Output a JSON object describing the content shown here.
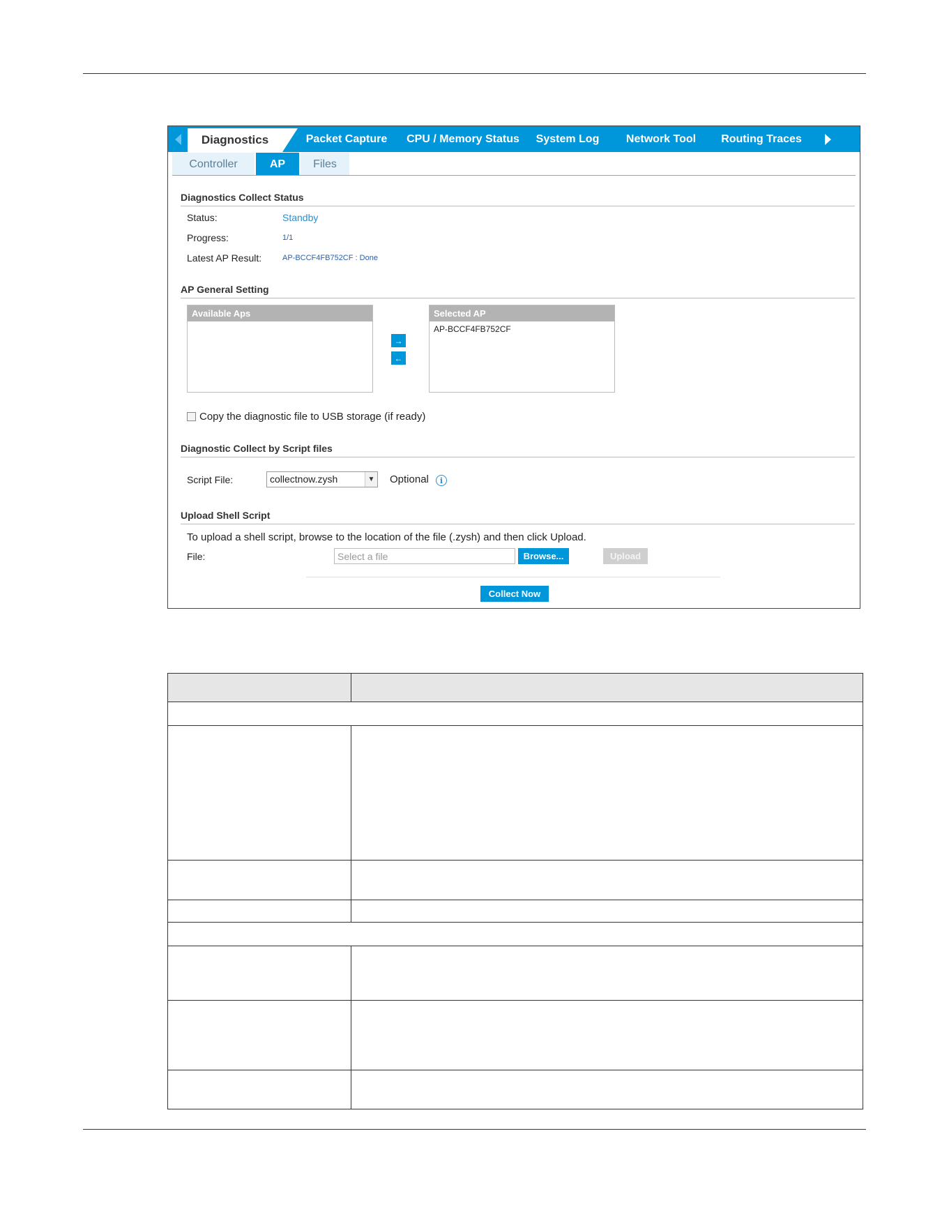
{
  "tabs": {
    "items": [
      "Diagnostics",
      "Packet Capture",
      "CPU / Memory Status",
      "System Log",
      "Network Tool",
      "Routing Traces"
    ],
    "active": "Diagnostics"
  },
  "subtabs": {
    "items": [
      "Controller",
      "AP",
      "Files"
    ],
    "active": "AP"
  },
  "collect_status": {
    "title": "Diagnostics Collect Status",
    "status_label": "Status:",
    "status_value": "Standby",
    "progress_label": "Progress:",
    "progress_value": "1/1",
    "latest_label": "Latest AP Result:",
    "latest_value": "AP-BCCF4FB752CF : Done"
  },
  "ap_general": {
    "title": "AP General Setting",
    "available_header": "Available Aps",
    "available_items": [],
    "selected_header": "Selected AP",
    "selected_items": [
      "AP-BCCF4FB752CF"
    ],
    "move_right_glyph": "→",
    "move_left_glyph": "←",
    "copy_usb_label": "Copy the diagnostic file to USB storage (if ready)",
    "copy_usb_checked": false
  },
  "script_files": {
    "title": "Diagnostic Collect by Script files",
    "script_label": "Script File:",
    "script_value": "collectnow.zysh",
    "optional_label": "Optional",
    "info_glyph": "i"
  },
  "upload": {
    "title": "Upload Shell Script",
    "instruction": "To upload a shell script, browse to the location of the file (.zysh) and then click Upload.",
    "file_label": "File:",
    "file_placeholder": "Select a file",
    "browse_label": "Browse...",
    "upload_label": "Upload"
  },
  "collect_now_label": "Collect Now",
  "colors": {
    "accent": "#0096da",
    "link": "#2c8fd0",
    "list_header": "#b3b3b3"
  },
  "icons": {
    "tab_scroll_left": "triangle-left-icon",
    "tab_scroll_right": "triangle-right-icon",
    "info": "info-icon",
    "caret": "chevron-down-icon"
  }
}
